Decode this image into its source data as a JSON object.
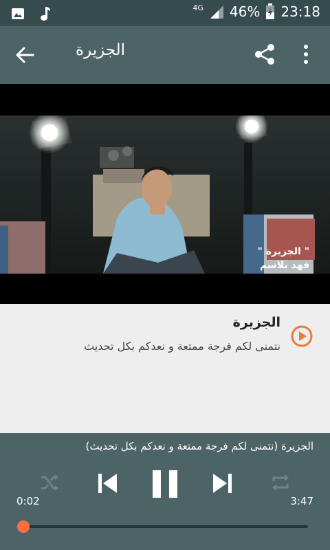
{
  "status": {
    "network": "4G",
    "battery": "46%",
    "time": "23:18"
  },
  "appbar": {
    "title": "الجزيرة"
  },
  "video": {
    "overlay_line1": "\" الجزيرة \"",
    "overlay_line2": "فهد بلاسم"
  },
  "track": {
    "title": "الجزيرة",
    "description": "نتمنى لكم فرجة ممتعة و نعدكم بكل تحديث"
  },
  "player": {
    "now_playing": "الجزيرة (نتمنى لكم فرجة ممتعة و نعدكم بكل تحديث)",
    "elapsed": "0:02",
    "duration": "3:47",
    "progress_fraction": 0.01
  },
  "colors": {
    "accent": "#ff6e40",
    "appbar": "#4c6466",
    "statusbar": "#354b4d"
  },
  "icons": [
    "image-icon",
    "music-note-icon",
    "signal-icon",
    "battery-icon",
    "back-arrow-icon",
    "share-icon",
    "more-vert-icon",
    "play-circle-icon",
    "shuffle-icon",
    "previous-icon",
    "pause-icon",
    "next-icon",
    "repeat-icon"
  ]
}
